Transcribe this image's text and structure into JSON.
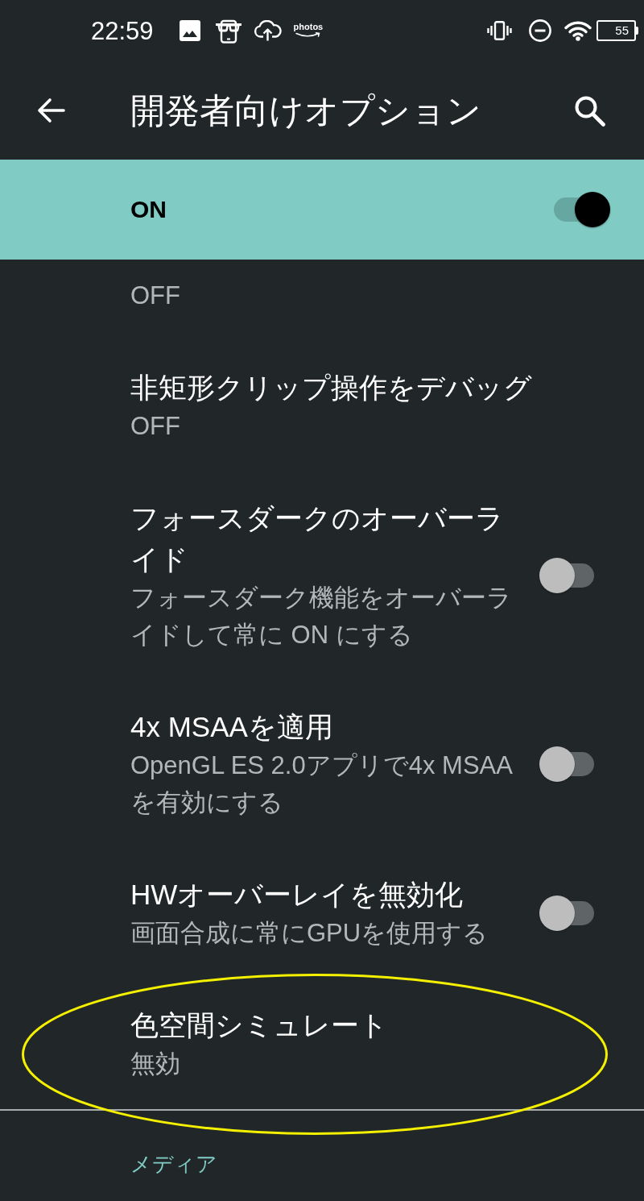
{
  "status_bar": {
    "time": "22:59",
    "photos_label": "photos",
    "battery": "55"
  },
  "app_bar": {
    "title": "開発者向けオプション"
  },
  "master_switch": {
    "label": "ON",
    "on": true
  },
  "settings": [
    {
      "kind": "text",
      "summary": "OFF",
      "circled": false
    },
    {
      "kind": "text",
      "title": "非矩形クリップ操作をデバッグ",
      "summary": "OFF",
      "circled": false
    },
    {
      "kind": "toggle",
      "title": "フォースダークのオーバーライド",
      "summary": "フォースダーク機能をオーバーライドして常に ON にする",
      "on": false,
      "circled": false
    },
    {
      "kind": "toggle",
      "title": "4x MSAAを適用",
      "summary": "OpenGL ES 2.0アプリで4x MSAAを有効にする",
      "on": false,
      "circled": false
    },
    {
      "kind": "toggle",
      "title": "HWオーバーレイを無効化",
      "summary": "画面合成に常にGPUを使用する",
      "on": false,
      "circled": false
    },
    {
      "kind": "text",
      "title": "色空間シミュレート",
      "summary": "無効",
      "circled": true
    }
  ],
  "category": {
    "title": "メディア"
  }
}
